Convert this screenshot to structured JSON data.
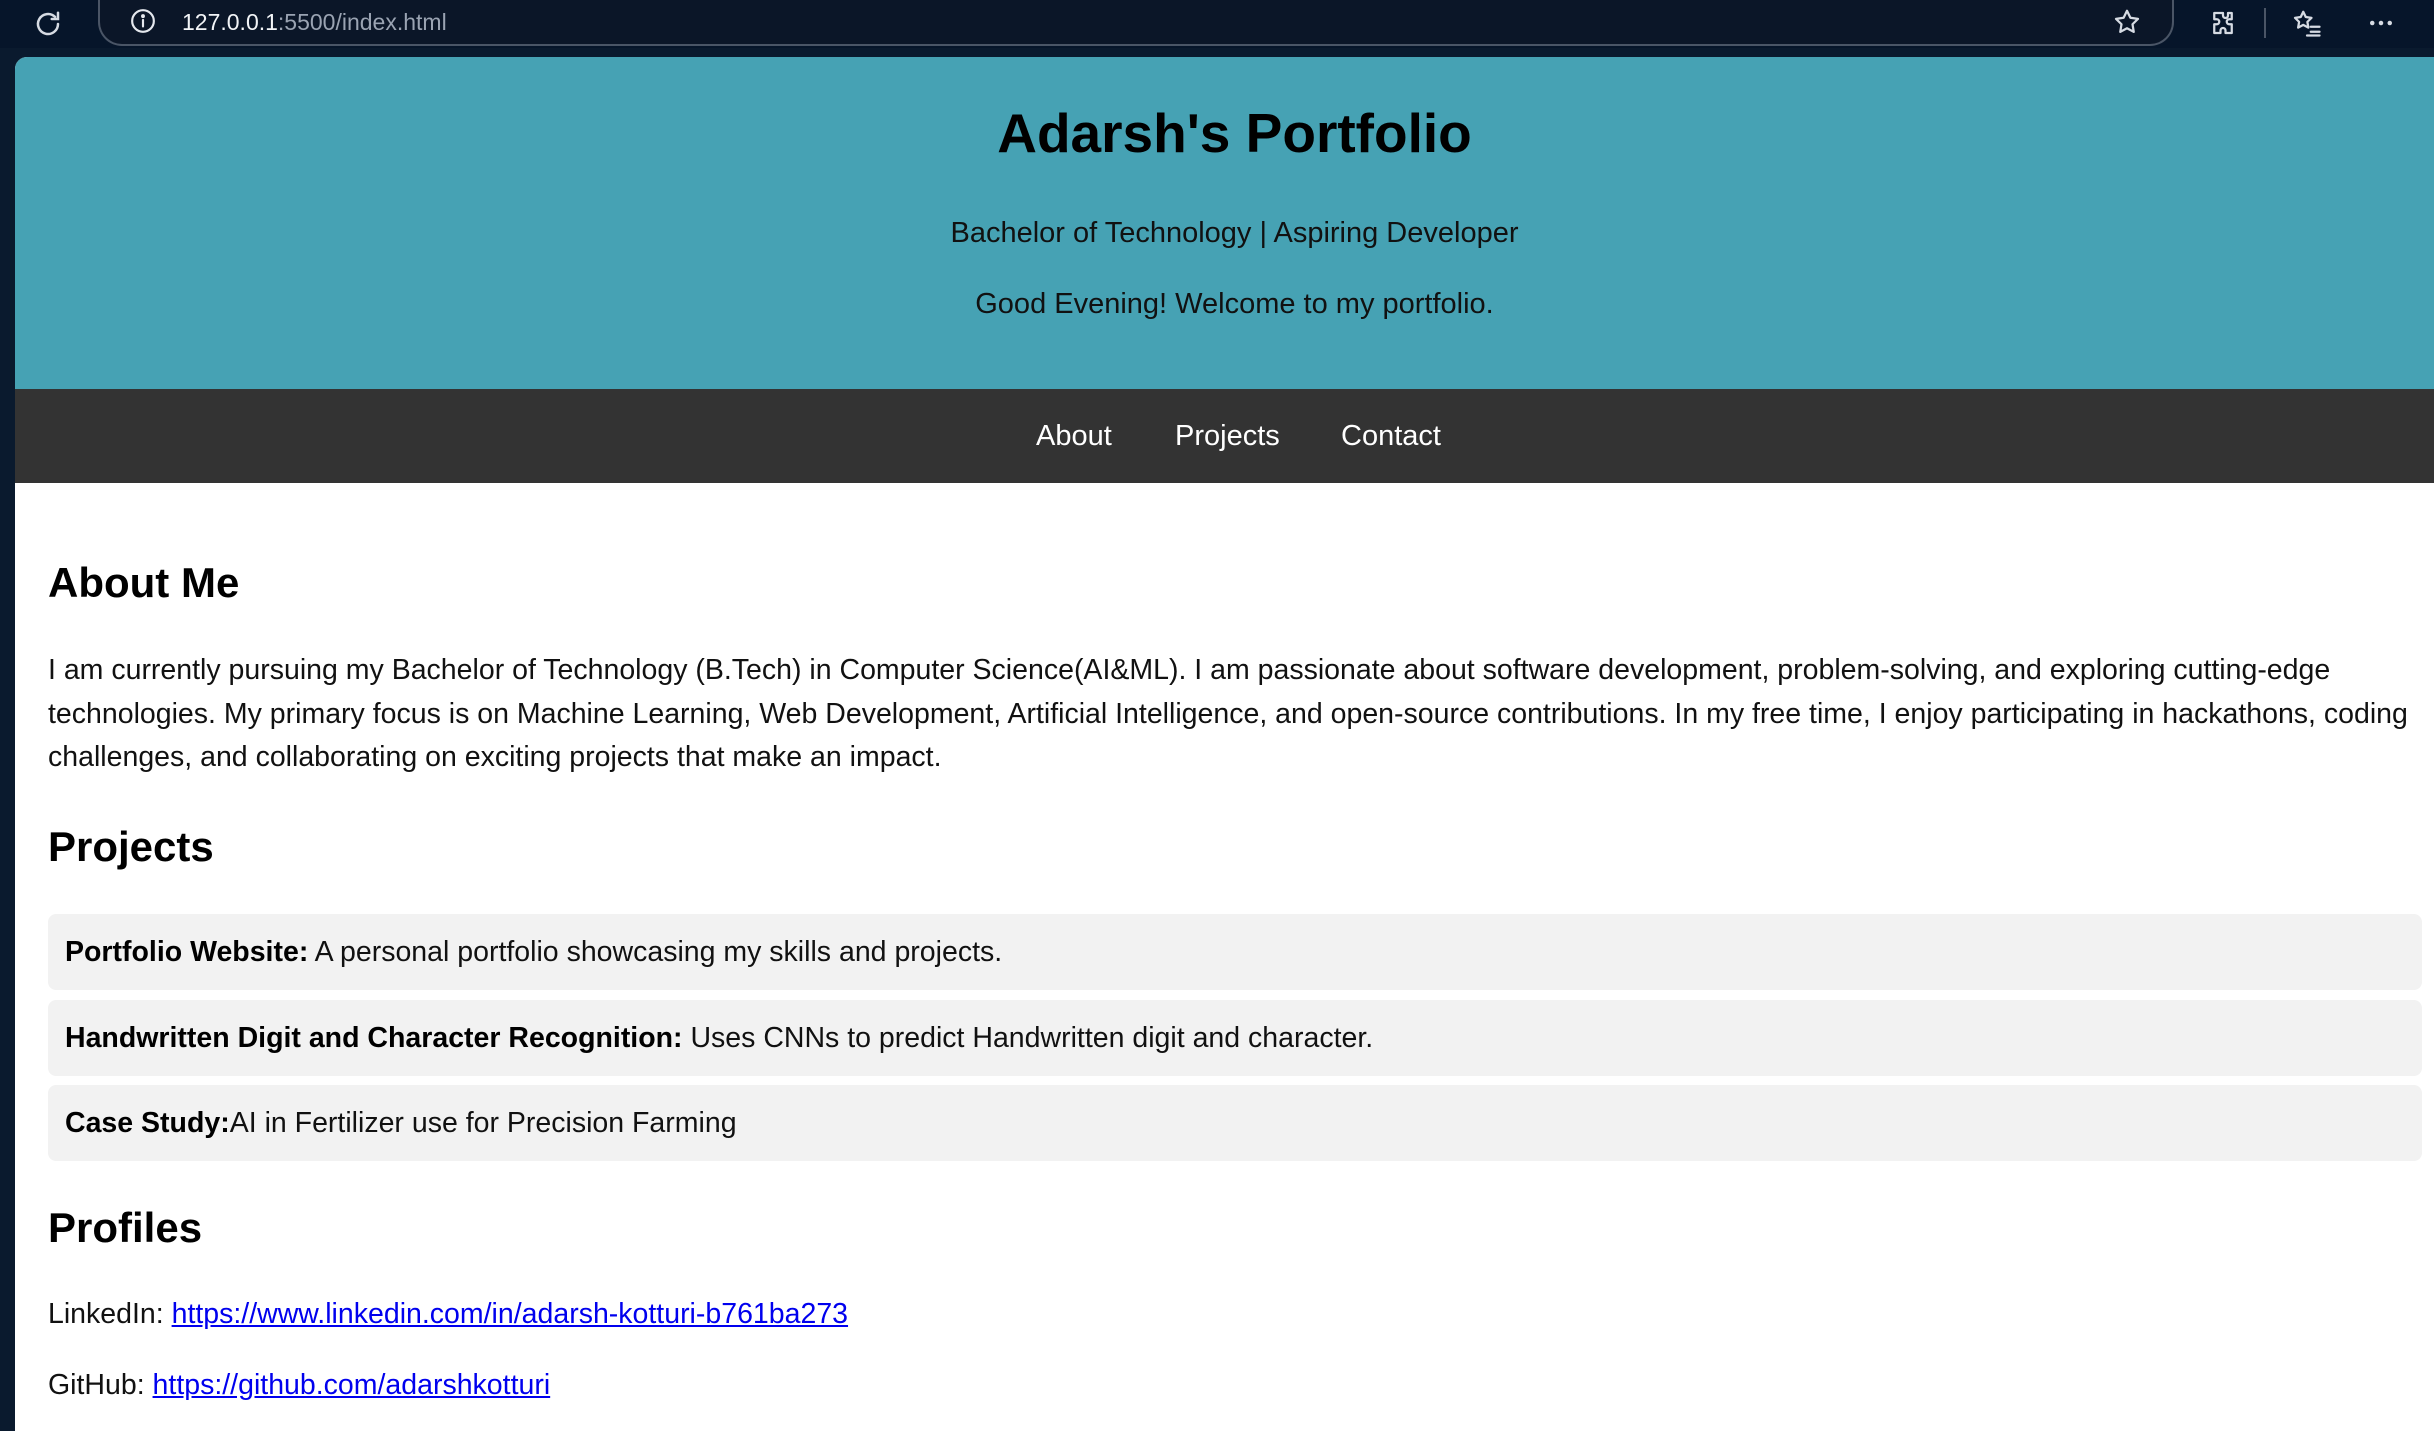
{
  "browser": {
    "url_host": "127.0.0.1",
    "url_rest": ":5500/index.html",
    "icons": [
      "reload-icon",
      "info-icon",
      "star-icon",
      "extensions-icon",
      "favorites-icon",
      "more-icon"
    ]
  },
  "header": {
    "title": "Adarsh's Portfolio",
    "subtitle": "Bachelor of Technology | Aspiring Developer",
    "greeting": "Good Evening! Welcome to my portfolio."
  },
  "nav": {
    "items": [
      {
        "label": "About"
      },
      {
        "label": "Projects"
      },
      {
        "label": "Contact"
      }
    ]
  },
  "about": {
    "heading": "About Me",
    "text": "I am currently pursuing my Bachelor of Technology (B.Tech) in Computer Science(AI&ML). I am passionate about software development, problem-solving, and exploring cutting-edge technologies. My primary focus is on Machine Learning, Web Development, Artificial Intelligence, and open-source contributions. In my free time, I enjoy participating in hackathons, coding challenges, and collaborating on exciting projects that make an impact."
  },
  "projects": {
    "heading": "Projects",
    "items": [
      {
        "title": "Portfolio Website:",
        "description": " A personal portfolio showcasing my skills and projects."
      },
      {
        "title": "Handwritten Digit and Character Recognition:",
        "description": " Uses CNNs to predict Handwritten digit and character."
      },
      {
        "title": "Case Study:",
        "description": "AI in Fertilizer use for Precision Farming"
      }
    ]
  },
  "profiles": {
    "heading": "Profiles",
    "items": [
      {
        "label": "LinkedIn: ",
        "url": "https://www.linkedin.com/in/adarsh-kotturi-b761ba273"
      },
      {
        "label": "GitHub: ",
        "url": "https://github.com/adarshkotturi"
      }
    ]
  },
  "colors": {
    "header_bg": "#46a2b4",
    "nav_bg": "#333333",
    "card_bg": "#f2f2f2",
    "link": "#0000ee",
    "browser_bg": "#06152a"
  }
}
